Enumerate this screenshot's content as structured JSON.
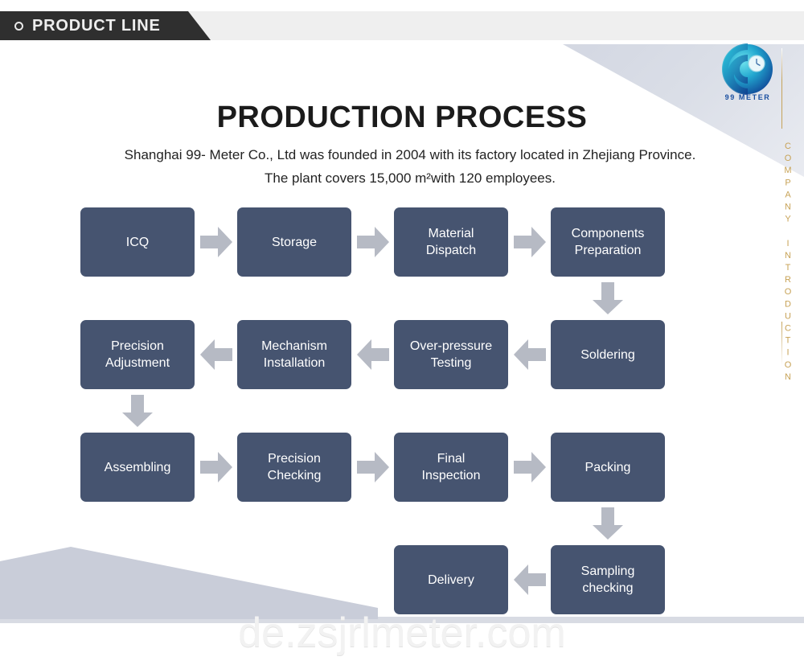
{
  "banner": {
    "label": "PRODUCT LINE",
    "bullet_icon": "circle-icon",
    "bg_color": "#2f2f2f",
    "text_color": "#eeeeee"
  },
  "logo": {
    "brand": "99 METER",
    "icon": "spiral-meter-logo-icon",
    "colors": [
      "#1d4fa0",
      "#1fa9c9",
      "#23c5d6",
      "#0e3d8c"
    ]
  },
  "side": {
    "vertical_text": "COMPANY INTRODUCTION",
    "rule_color": "#c6a35a"
  },
  "heading": {
    "title": "PRODUCTION PROCESS",
    "paragraph": "Shanghai 99- Meter Co., Ltd was founded in 2004 with its factory located in Zhejiang Province. The plant covers 15,000 m²with 120 employees."
  },
  "flow": {
    "node_color": "#465470",
    "node_text_color": "#ffffff",
    "arrow_color": "#b6bac4",
    "rows": [
      {
        "direction": "right",
        "nodes": [
          {
            "label": "ICQ"
          },
          {
            "label": "Storage"
          },
          {
            "label": "Material\nDispatch"
          },
          {
            "label": "Components\nPreparation"
          }
        ]
      },
      {
        "direction": "left",
        "nodes": [
          {
            "label": "Soldering"
          },
          {
            "label": "Over-pressure\nTesting"
          },
          {
            "label": "Mechanism\nInstallation"
          },
          {
            "label": "Precision\nAdjustment"
          }
        ]
      },
      {
        "direction": "right",
        "nodes": [
          {
            "label": "Assembling"
          },
          {
            "label": "Precision\nChecking"
          },
          {
            "label": "Final\nInspection"
          },
          {
            "label": "Packing"
          }
        ]
      },
      {
        "direction": "left",
        "nodes": [
          {
            "label": "Delivery"
          },
          {
            "label": "Sampling\nchecking"
          }
        ]
      }
    ],
    "connectors": [
      {
        "name": "arrow-down-components-to-precision"
      },
      {
        "name": "arrow-down-soldering-to-assembling"
      },
      {
        "name": "arrow-down-packing-to-sampling"
      }
    ]
  },
  "watermark": {
    "text": "de.zsjrlmeter.com"
  }
}
